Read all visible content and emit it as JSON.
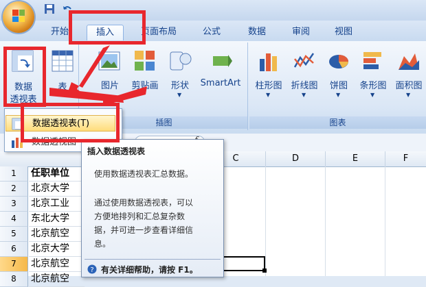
{
  "tabs": [
    "开始",
    "插入",
    "页面布局",
    "公式",
    "数据",
    "审阅",
    "视图"
  ],
  "ribbon": {
    "pivot_table": {
      "line1": "数据",
      "line2": "透视表"
    },
    "table": "表",
    "illustrations": {
      "picture": "图片",
      "clipart": "剪贴画",
      "shapes": "形状",
      "smartart": "SmartArt",
      "group_label": "插图"
    },
    "charts": {
      "column": "柱形图",
      "line": "折线图",
      "pie": "饼图",
      "bar": "条形图",
      "area": "面积图",
      "group_label": "图表"
    }
  },
  "menu": {
    "item1": "数据透视表(T)",
    "item2": "数据透视图"
  },
  "tooltip": {
    "title": "插入数据透视表",
    "line1": "使用数据透视表汇总数据。",
    "line2a": "通过使用数据透视表，可以",
    "line2b": "方便地排列和汇总复杂数",
    "line2c": "据，并可进一步查看详细信",
    "line2d": "息。",
    "help": "有关详细帮助，请按 F1。"
  },
  "formula": {
    "fx": "f"
  },
  "columns": [
    "C",
    "D",
    "E",
    "F"
  ],
  "rows": [
    "1",
    "2",
    "3",
    "4",
    "5",
    "6",
    "7",
    "8"
  ],
  "cells": [
    "任职单位",
    "北京大学",
    "北京工业",
    "东北大学",
    "北京航空",
    "北京大学",
    "北京航空",
    "北京航空"
  ],
  "colors": {
    "highlight": "#e8272d",
    "ribbon": "#dbe7f6",
    "accent": "#15428b"
  }
}
